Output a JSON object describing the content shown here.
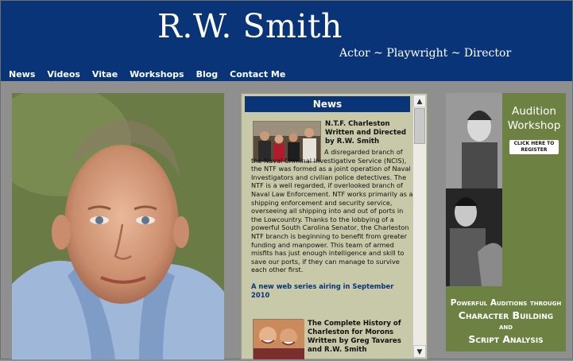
{
  "header": {
    "title": "R.W. Smith",
    "tagline": "Actor ~ Playwright ~ Director"
  },
  "nav": {
    "items": [
      "News",
      "Videos",
      "Vitae",
      "Workshops",
      "Blog",
      "Contact Me"
    ]
  },
  "news": {
    "heading": "News",
    "story1": {
      "title": "N.T.F. Charleston Written and Directed by R.W. Smith",
      "body": "A disregarded branch of the Naval Criminal Investigative Service (NCIS), the NTF was formed as a joint operation of Naval Investigators and civilian police detectives. The NTF is a well regarded, if overlooked branch of Naval Law Enforcement. NTF works primarily as a shipping enforcement and security service, overseeing all shipping into and out of ports in the Lowcountry. Thanks to the lobbying of a powerful South Carolina Senator, the Charleston NTF branch is beginning to benefit from greater funding and manpower. This team of armed misfits has just enough intelligence and skill to save our ports, if they can manage to survive each other first.",
      "link": "A new web series airing in September 2010"
    },
    "story2": {
      "title": "The Complete History of Charleston for Morons Written by Greg Tavares and R.W. Smith"
    },
    "scroll_up": "▲",
    "scroll_down": "▼"
  },
  "ad": {
    "title": "Audition Workshop",
    "register": "CLICK HERE TO REGISTER",
    "caption_line1": "Powerful Auditions through",
    "caption_line2": "Character Building",
    "caption_line3": "and",
    "caption_line4": "Script Analysis"
  },
  "colors": {
    "header_bg": "#0a3478",
    "news_bg": "#c7c9a9",
    "ad_bg": "#6d8142",
    "page_bg": "#8f8f8f"
  }
}
